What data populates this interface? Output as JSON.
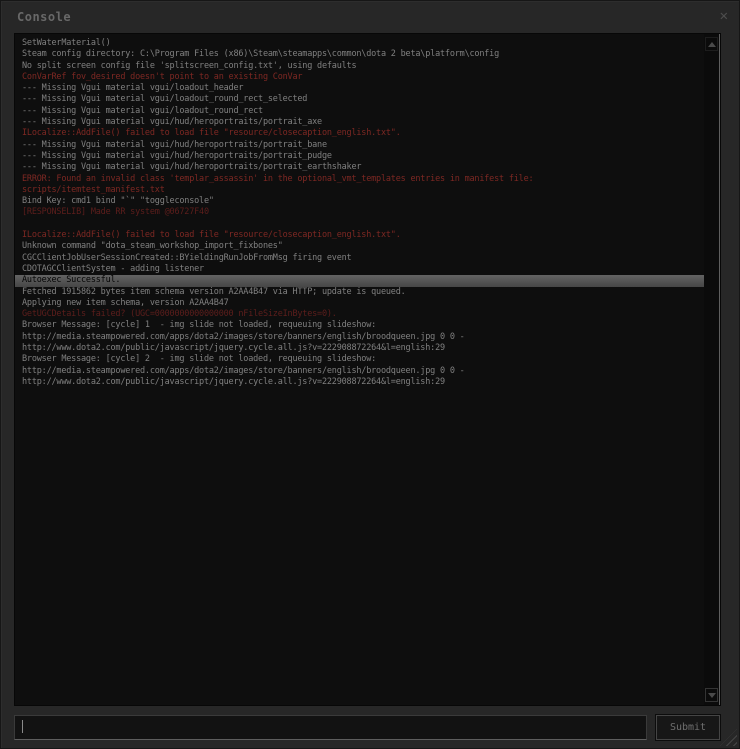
{
  "window": {
    "title": "Console",
    "close_icon": "✕"
  },
  "console": {
    "lines": [
      {
        "style": "normal",
        "text": "SetWaterMaterial()"
      },
      {
        "style": "normal",
        "text": "Steam config directory: C:\\Program Files (x86)\\Steam\\steamapps\\common\\dota 2 beta\\platform\\config"
      },
      {
        "style": "normal",
        "text": "No split screen config file 'splitscreen_config.txt', using defaults"
      },
      {
        "style": "error",
        "text": "ConVarRef fov_desired doesn't point to an existing ConVar"
      },
      {
        "style": "normal",
        "text": "--- Missing Vgui material vgui/loadout_header"
      },
      {
        "style": "normal",
        "text": "--- Missing Vgui material vgui/loadout_round_rect_selected"
      },
      {
        "style": "normal",
        "text": "--- Missing Vgui material vgui/loadout_round_rect"
      },
      {
        "style": "normal",
        "text": "--- Missing Vgui material vgui/hud/heroportraits/portrait_axe"
      },
      {
        "style": "error",
        "text": "ILocalize::AddFile() failed to load file \"resource/closecaption_english.txt\"."
      },
      {
        "style": "normal",
        "text": "--- Missing Vgui material vgui/hud/heroportraits/portrait_bane"
      },
      {
        "style": "normal",
        "text": "--- Missing Vgui material vgui/hud/heroportraits/portrait_pudge"
      },
      {
        "style": "normal",
        "text": "--- Missing Vgui material vgui/hud/heroportraits/portrait_earthshaker"
      },
      {
        "style": "error",
        "text": "ERROR: Found an invalid class 'templar_assassin' in the optional_vmt_templates entries in manifest file:"
      },
      {
        "style": "error",
        "text": "scripts/itemtest_manifest.txt"
      },
      {
        "style": "normal",
        "text": "Bind Key: cmd1 bind \"`\" \"toggleconsole\""
      },
      {
        "style": "error-dim",
        "text": "[RESPONSELIB] Made RR system @06727F40"
      },
      {
        "style": "normal",
        "text": ""
      },
      {
        "style": "error",
        "text": "ILocalize::AddFile() failed to load file \"resource/closecaption_english.txt\"."
      },
      {
        "style": "normal",
        "text": "Unknown command \"dota_steam_workshop_import_fixbones\""
      },
      {
        "style": "normal",
        "text": "CGCClientJobUserSessionCreated::BYieldingRunJobFromMsg firing event"
      },
      {
        "style": "normal",
        "text": "CDOTAGCClientSystem - adding listener"
      },
      {
        "style": "highlight",
        "text": "Autoexec Successful."
      },
      {
        "style": "normal",
        "text": "Fetched 1915862 bytes item schema version A2AA4B47 via HTTP; update is queued."
      },
      {
        "style": "normal",
        "text": "Applying new item schema, version A2AA4B47"
      },
      {
        "style": "error-dim",
        "text": "GetUGCDetails failed? (UGC=0000000000000000 nFileSizeInBytes=0)."
      },
      {
        "style": "normal",
        "text": "Browser Message: [cycle] 1  - img slide not loaded, requeuing slideshow:"
      },
      {
        "style": "normal",
        "text": "http://media.steampowered.com/apps/dota2/images/store/banners/english/broodqueen.jpg 0 0 -"
      },
      {
        "style": "normal",
        "text": "http://www.dota2.com/public/javascript/jquery.cycle.all.js?v=222908872264&l=english:29"
      },
      {
        "style": "normal",
        "text": "Browser Message: [cycle] 2  - img slide not loaded, requeuing slideshow:"
      },
      {
        "style": "normal",
        "text": "http://media.steampowered.com/apps/dota2/images/store/banners/english/broodqueen.jpg 0 0 -"
      },
      {
        "style": "normal",
        "text": "http://www.dota2.com/public/javascript/jquery.cycle.all.js?v=222908872264&l=english:29"
      }
    ]
  },
  "controls": {
    "input_value": "",
    "submit_label": "Submit"
  },
  "colors": {
    "window_bg": "#272727",
    "console_bg": "#0e0e0e",
    "text_normal": "#808080",
    "text_error": "#7e2823",
    "text_error_dim": "#5d1e1c",
    "highlight_bg": "#555555",
    "highlight_text": "#040404",
    "title_text": "#686868"
  }
}
